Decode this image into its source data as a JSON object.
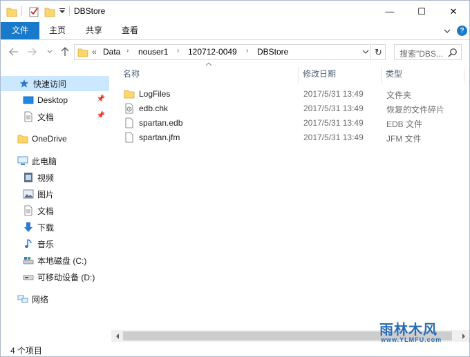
{
  "window": {
    "title": "DBStore",
    "minimize_glyph": "—",
    "maximize_glyph": "☐",
    "close_glyph": "✕"
  },
  "ribbon": {
    "tabs": [
      "文件",
      "主页",
      "共享",
      "查看"
    ],
    "expand_glyph": "⌄",
    "help_glyph": "?"
  },
  "address": {
    "overflow": "«",
    "crumbs": [
      "Data",
      "nouser1",
      "120712-0049",
      "DBStore"
    ],
    "separator": "›",
    "refresh_glyph": "↻",
    "dropdown_glyph": "⌄"
  },
  "search": {
    "placeholder": "搜索\"DBS..."
  },
  "navpane": {
    "quick_access": "快速访问",
    "pinned": [
      "Desktop",
      "文档"
    ],
    "onedrive": "OneDrive",
    "this_pc": "此电脑",
    "pc_items": [
      "视频",
      "图片",
      "文档",
      "下载",
      "音乐",
      "本地磁盘 (C:)",
      "可移动设备 (D:)"
    ],
    "network": "网络"
  },
  "columns": {
    "name": "名称",
    "date": "修改日期",
    "type": "类型"
  },
  "files": [
    {
      "name": "LogFiles",
      "date": "2017/5/31 13:49",
      "type": "文件夹",
      "icon": "folder-icon"
    },
    {
      "name": "edb.chk",
      "date": "2017/5/31 13:49",
      "type": "恢复的文件碎片",
      "icon": "chk-file-icon"
    },
    {
      "name": "spartan.edb",
      "date": "2017/5/31 13:49",
      "type": "EDB 文件",
      "icon": "file-icon"
    },
    {
      "name": "spartan.jfm",
      "date": "2017/5/31 13:49",
      "type": "JFM 文件",
      "icon": "file-icon"
    }
  ],
  "status": {
    "item_count": "4 个项目"
  },
  "watermark": {
    "title": "雨林木风",
    "url": "www.YLMFU.com"
  },
  "colors": {
    "accent": "#1979ca",
    "selection": "#cce8ff",
    "folder": "#ffd66b"
  }
}
